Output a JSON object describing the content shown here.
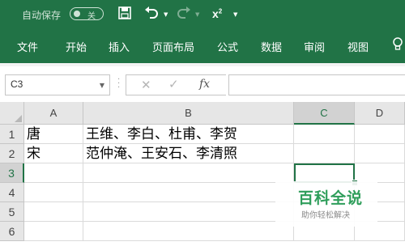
{
  "quick_access": {
    "autosave_label": "自动保存",
    "autosave_state": "关",
    "icons": [
      "save-icon",
      "undo-icon",
      "redo-icon",
      "superscript-icon"
    ],
    "superscript_label": "x²"
  },
  "ribbon": {
    "tabs": [
      "文件",
      "开始",
      "插入",
      "页面布局",
      "公式",
      "数据",
      "审阅",
      "视图"
    ]
  },
  "formula_bar": {
    "name_box": "C3",
    "fx_label": "fx",
    "formula_value": ""
  },
  "sheet": {
    "columns": [
      "A",
      "B",
      "C",
      "D"
    ],
    "selected_column": "C",
    "rows": [
      "1",
      "2",
      "3",
      "4",
      "5",
      "6"
    ],
    "selected_row": "3",
    "active_cell": "C3",
    "cells": {
      "A1": "唐",
      "B1": "王维、李白、杜甫、李贺",
      "A2": "宋",
      "B2": "范仲淹、王安石、李清照"
    }
  },
  "watermark": {
    "title": "百科全说",
    "subtitle": "助你轻松解决"
  },
  "colors": {
    "accent": "#217346",
    "watermark_green": "#2f9e5b"
  }
}
